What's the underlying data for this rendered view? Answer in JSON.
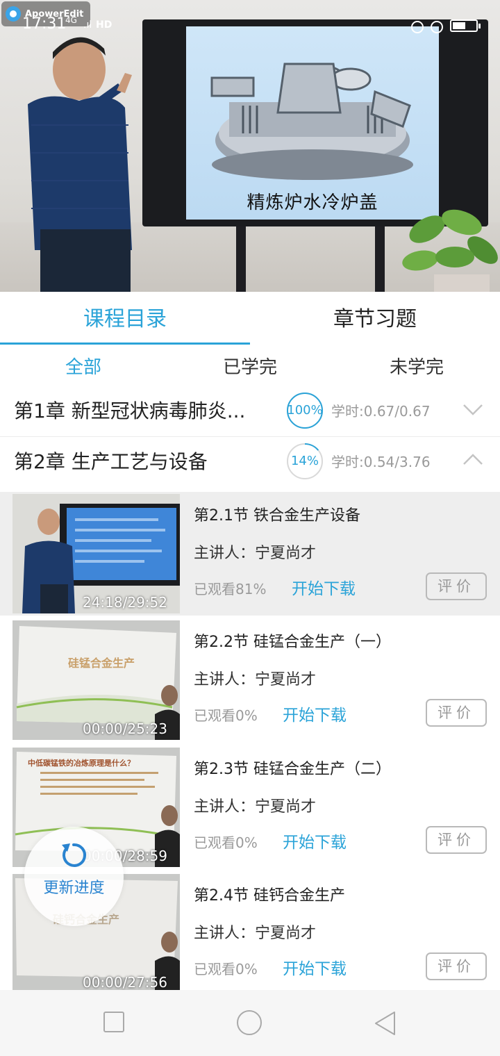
{
  "status_bar": {
    "recorder_label": "ApowerEdit",
    "time": "17:31",
    "network": "4G",
    "signal_text": ".ıl",
    "hd_label": "HD"
  },
  "video": {
    "screen_caption": "精炼炉水冷炉盖"
  },
  "tabs": [
    {
      "label": "课程目录",
      "active": true
    },
    {
      "label": "章节习题",
      "active": false
    }
  ],
  "filters": [
    {
      "label": "全部",
      "active": true
    },
    {
      "label": "已学完",
      "active": false
    },
    {
      "label": "未学完",
      "active": false
    }
  ],
  "chapters": [
    {
      "title": "第1章 新型冠状病毒肺炎...",
      "progress_label": "100%",
      "progress": 1.0,
      "hours": "学时:0.67/0.67",
      "expanded": false
    },
    {
      "title": "第2章 生产工艺与设备",
      "progress_label": "14%",
      "progress": 0.14,
      "hours": "学时:0.54/3.76",
      "expanded": true
    }
  ],
  "lessons": [
    {
      "title": "第2.1节  铁合金生产设备",
      "lecturer": "主讲人：宁夏尚才",
      "watched": "已观看81%",
      "download": "开始下载",
      "rate": "评价",
      "duration": "24:18/29:52"
    },
    {
      "title": "第2.2节  硅锰合金生产（一）",
      "lecturer": "主讲人：宁夏尚才",
      "watched": "已观看0%",
      "download": "开始下载",
      "rate": "评价",
      "duration": "00:00/25:23",
      "slide_text": "硅锰合金生产"
    },
    {
      "title": "第2.3节  硅锰合金生产（二）",
      "lecturer": "主讲人：宁夏尚才",
      "watched": "已观看0%",
      "download": "开始下载",
      "rate": "评价",
      "duration": "00:00/28:59",
      "slide_text": "中低碳锰铁的冶炼原理是什么？"
    },
    {
      "title": "第2.4节  硅钙合金生产",
      "lecturer": "主讲人：宁夏尚才",
      "watched": "已观看0%",
      "download": "开始下载",
      "rate": "评价",
      "duration": "00:00/27:56",
      "slide_text": "硅钙合金生产"
    }
  ],
  "refresh_badge": {
    "label": "更新进度"
  },
  "colors": {
    "accent": "#2aa3d8",
    "muted": "#9a9a9a"
  }
}
